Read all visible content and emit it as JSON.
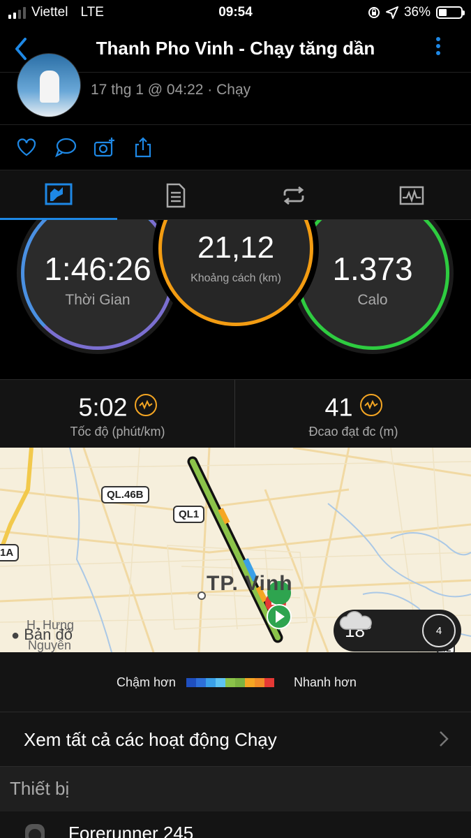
{
  "status_bar": {
    "carrier": "Viettel",
    "network": "LTE",
    "time": "09:54",
    "battery_percent": "36%",
    "battery_level": 0.36
  },
  "nav": {
    "title": "Thanh Pho Vinh - Chạy tăng dần",
    "accent_color": "#1e88e5"
  },
  "activity": {
    "subtitle": "17 thg 1 @ 04:22 · Chạy"
  },
  "action_icons": [
    "heart-icon",
    "comment-icon",
    "camera-add-icon",
    "share-icon"
  ],
  "tabs": [
    {
      "name": "summary",
      "icon": "summary-chart-icon",
      "active": true
    },
    {
      "name": "details",
      "icon": "document-list-icon",
      "active": false
    },
    {
      "name": "laps",
      "icon": "repeat-icon",
      "active": false
    },
    {
      "name": "charts",
      "icon": "line-chart-icon",
      "active": false
    }
  ],
  "stats": {
    "time": {
      "value": "1:46:26",
      "label": "Thời Gian",
      "color": "#7b6fd0"
    },
    "distance": {
      "value": "21,12",
      "label": "Khoảng cách (km)",
      "color": "#f39c12"
    },
    "calories": {
      "value": "1.373",
      "label": "Calo",
      "color": "#2ecc40"
    }
  },
  "metrics": {
    "pace": {
      "value": "5:02",
      "label": "Tốc độ (phút/km)"
    },
    "elevation": {
      "value": "41",
      "label": "Đcao đạt đc (m)"
    }
  },
  "map": {
    "road_labels": [
      "QL.46B",
      "QL1",
      "1A",
      "42"
    ],
    "city": "TP. Vinh",
    "place_label_1": "H. Hưng",
    "place_label_2": "Nguyên",
    "attribution": "Bản đồ",
    "weather_temp": "18°",
    "wind_speed": "4"
  },
  "legend": {
    "slower": "Chậm hơn",
    "faster": "Nhanh hơn",
    "colors": [
      "#1f4fbf",
      "#2d6fd8",
      "#3aa0e8",
      "#5ec3f2",
      "#8bc34a",
      "#7cb342",
      "#f5a623",
      "#f28c28",
      "#e53935"
    ]
  },
  "all_activities": {
    "label": "Xem tất cả các hoạt động Chạy"
  },
  "devices": {
    "heading": "Thiết bị",
    "device_name": "Forerunner 245"
  }
}
